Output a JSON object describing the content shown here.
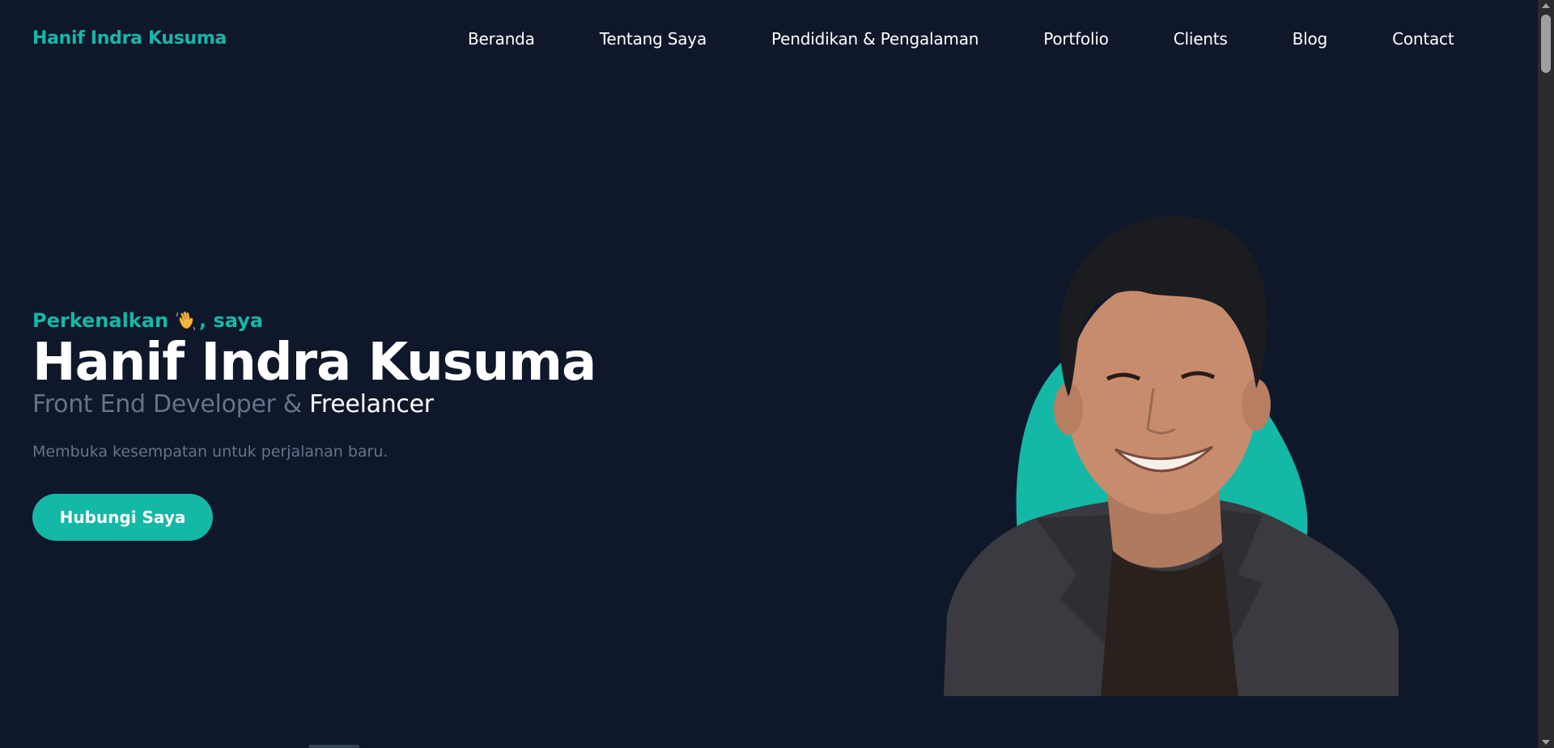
{
  "colors": {
    "background": "#0f172a",
    "accent": "#14b8a6",
    "muted": "#64748b",
    "text": "#ffffff"
  },
  "header": {
    "brand": "Hanif Indra Kusuma",
    "nav": [
      {
        "label": "Beranda"
      },
      {
        "label": "Tentang Saya"
      },
      {
        "label": "Pendidikan & Pengalaman"
      },
      {
        "label": "Portfolio"
      },
      {
        "label": "Clients"
      },
      {
        "label": "Blog"
      },
      {
        "label": "Contact"
      }
    ]
  },
  "hero": {
    "greeting_before": "Perkenalkan",
    "greeting_icon": "waving-hand-icon",
    "greeting_after": ", saya",
    "name": "Hanif Indra Kusuma",
    "role_muted": "Front End Developer & ",
    "role_accent": "Freelancer",
    "tagline": "Membuka kesempatan untuk perjalanan baru.",
    "cta_label": "Hubungi Saya"
  },
  "portrait": {
    "icon": "profile-photo"
  }
}
